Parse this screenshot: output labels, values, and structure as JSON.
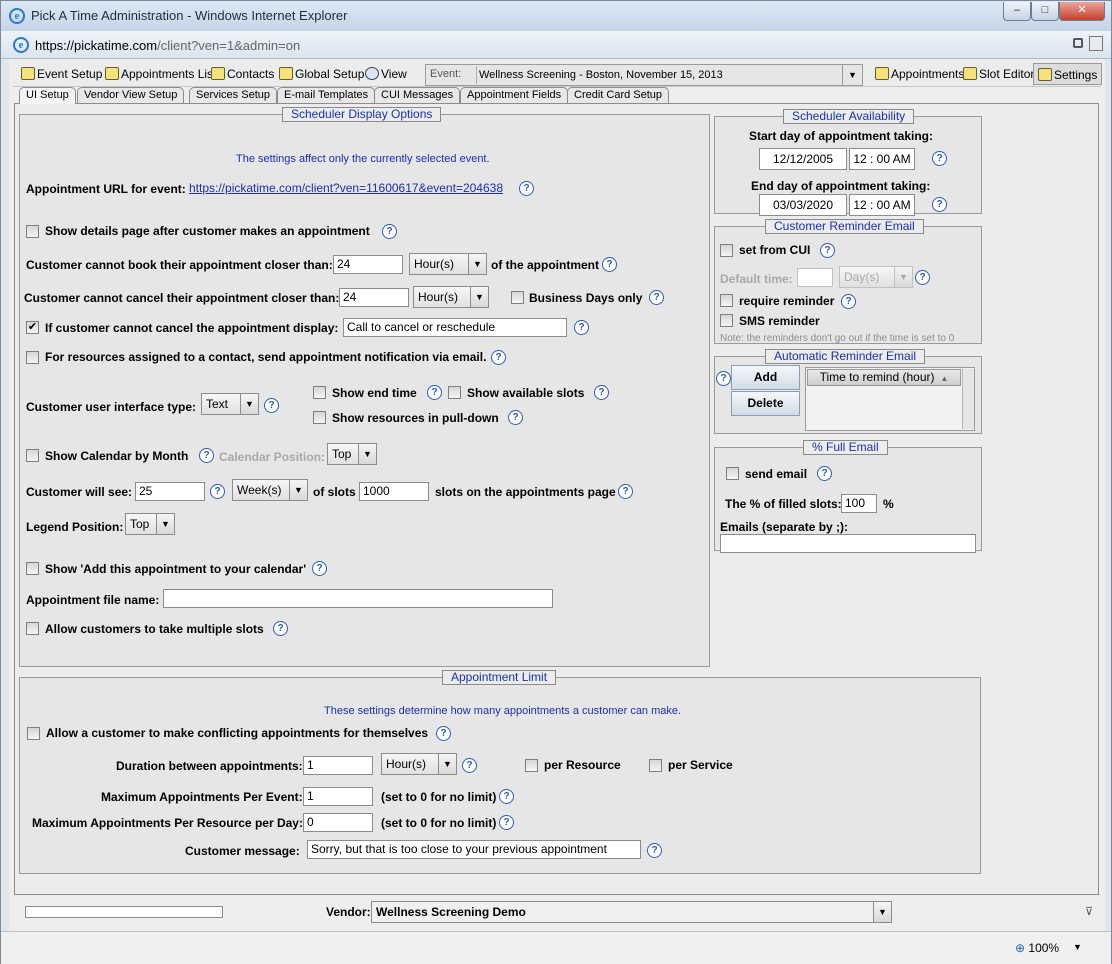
{
  "window": {
    "title": "Pick A Time Administration - Windows Internet Explorer",
    "minimize": "–",
    "maximize": "□",
    "close": "✕"
  },
  "address": {
    "url_prefix": "https://pickatime.com",
    "url_rest": "/client?ven=1&admin=on"
  },
  "toolbar": {
    "event_setup": "Event Setup",
    "appointments_list": "Appointments Lis",
    "contacts": "Contacts",
    "global_setup": "Global Setup",
    "view": "View",
    "event_label": "Event:",
    "event_value": "Wellness Screening - Boston, November 15, 2013",
    "appointments": "Appointments",
    "slot_editor": "Slot Editor",
    "settings": "Settings"
  },
  "tabs": [
    "UI Setup",
    "Vendor View Setup",
    "Services Setup",
    "E-mail Templates",
    "CUI Messages",
    "Appointment Fields",
    "Credit Card Setup"
  ],
  "display": {
    "title": "Scheduler Display Options",
    "note": "The settings affect only the currently selected event.",
    "url_label": "Appointment URL for event:",
    "url_value": "https://pickatime.com/client?ven=11600617&event=204638",
    "show_details": "Show details page after customer makes an appointment",
    "book_closer_label": "Customer cannot book their appointment closer than:",
    "book_closer_value": "24",
    "book_closer_unit": "Hour(s)",
    "book_closer_suffix": "of the appointment",
    "cancel_closer_label": "Customer cannot cancel their appointment closer than:",
    "cancel_closer_value": "24",
    "cancel_closer_unit": "Hour(s)",
    "business_days": "Business Days only",
    "cancel_display_label": "If customer cannot cancel the appointment display:",
    "cancel_display_value": "Call to cancel or reschedule",
    "resources_notify": "For resources assigned to a contact, send appointment notification via email.",
    "ui_type_label": "Customer user interface type:",
    "ui_type_value": "Text",
    "show_end_time": "Show end time",
    "show_available_slots": "Show available slots",
    "show_resources_pulldown": "Show resources in pull-down",
    "calendar_by_month": "Show Calendar by Month",
    "calendar_position_label": "Calendar Position:",
    "calendar_position_value": "Top",
    "customer_see_label": "Customer will see:",
    "customer_see_value": "25",
    "customer_see_unit": "Week(s)",
    "of_slots": "of slots",
    "slots_value": "1000",
    "slots_suffix": "slots on the appointments page",
    "legend_label": "Legend Position:",
    "legend_value": "Top",
    "add_calendar": "Show 'Add this appointment to your calendar'",
    "file_name_label": "Appointment file name:",
    "file_name_value": "",
    "multiple_slots": "Allow customers to take multiple slots"
  },
  "availability": {
    "title": "Scheduler Availability",
    "start_label": "Start day of appointment taking:",
    "start_date": "12/12/2005",
    "start_time": "12 : 00 AM",
    "end_label": "End day of appointment taking:",
    "end_date": "03/03/2020",
    "end_time": "12 : 00 AM"
  },
  "reminder": {
    "title": "Customer Reminder Email",
    "set_from_cui": "set from CUI",
    "default_time_label": "Default time:",
    "default_time_unit": "Day(s)",
    "require_reminder": "require reminder",
    "sms_reminder": "SMS reminder",
    "note": "Note: the reminders don't go out if the time is set to 0"
  },
  "auto_reminder": {
    "title": "Automatic Reminder Email",
    "add": "Add",
    "delete": "Delete",
    "column": "Time to remind (hour)"
  },
  "full_email": {
    "title": "% Full Email",
    "send_email": "send email",
    "filled_label": "The % of filled slots:",
    "filled_value": "100",
    "percent": "%",
    "emails_label": "Emails (separate by ;):",
    "emails_value": ""
  },
  "limit": {
    "title": "Appointment Limit",
    "note": "These settings determine how many appointments a customer can make.",
    "conflicting": "Allow a customer to make conflicting appointments for themselves",
    "duration_label": "Duration between appointments:",
    "duration_value": "1",
    "duration_unit": "Hour(s)",
    "per_resource": "per Resource",
    "per_service": "per Service",
    "max_event_label": "Maximum Appointments Per Event:",
    "max_event_value": "1",
    "max_resource_label": "Maximum Appointments Per Resource per Day:",
    "max_resource_value": "0",
    "no_limit": "(set to 0 for no limit)",
    "message_label": "Customer message:",
    "message_value": "Sorry, but that is too close to your previous appointment"
  },
  "footer": {
    "vendor_label": "Vendor:",
    "vendor_value": "Wellness Screening Demo"
  },
  "statusbar": {
    "zoom": "100%"
  },
  "checkbox_state": {
    "cancel_display": "✔"
  }
}
